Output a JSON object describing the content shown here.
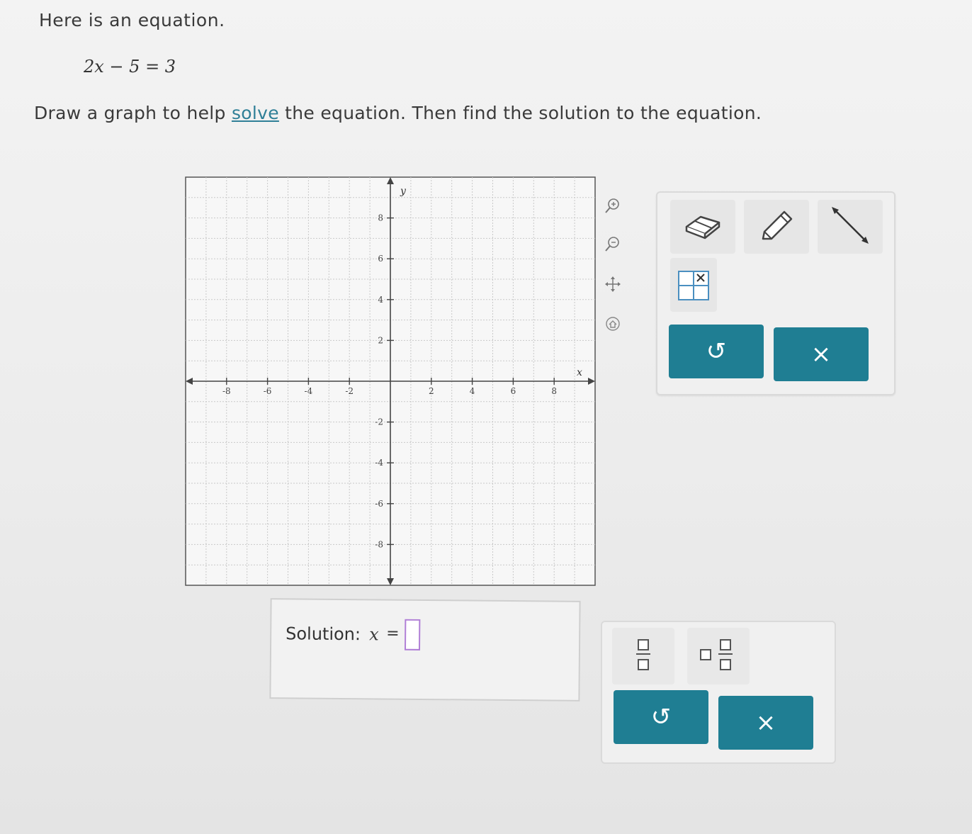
{
  "question": {
    "intro": "Here is an equation.",
    "equation": "2x − 5 = 3",
    "instruction_before": "Draw a graph to help ",
    "instruction_link": "solve",
    "instruction_after": " the equation. Then find the solution to the equation."
  },
  "graph": {
    "x_axis_label": "x",
    "y_axis_label": "y",
    "x_ticks": [
      "-8",
      "-6",
      "-4",
      "-2",
      "2",
      "4",
      "6",
      "8"
    ],
    "y_ticks": [
      "8",
      "6",
      "4",
      "2",
      "-2",
      "-4",
      "-6",
      "-8"
    ],
    "range": {
      "xmin": -10,
      "xmax": 10,
      "ymin": -10,
      "ymax": 10
    },
    "gridlines": true
  },
  "side_tools": [
    "zoom-in-icon",
    "zoom-out-icon",
    "move-icon",
    "home-icon"
  ],
  "graph_tools": [
    "eraser-icon",
    "pencil-icon",
    "line-segment-icon",
    "table-icon",
    "undo-icon",
    "clear-icon"
  ],
  "solution": {
    "label": "Solution:",
    "variable": "x",
    "equals": "=",
    "value": ""
  },
  "answer_tools": [
    "fraction-icon",
    "mixed-number-icon",
    "undo-icon",
    "clear-icon"
  ],
  "buttons": {
    "undo_glyph": "↺",
    "clear_glyph": "×"
  },
  "colors": {
    "accent": "#1f7e93",
    "link": "#2f7f97",
    "input_border": "#b07fd6"
  }
}
